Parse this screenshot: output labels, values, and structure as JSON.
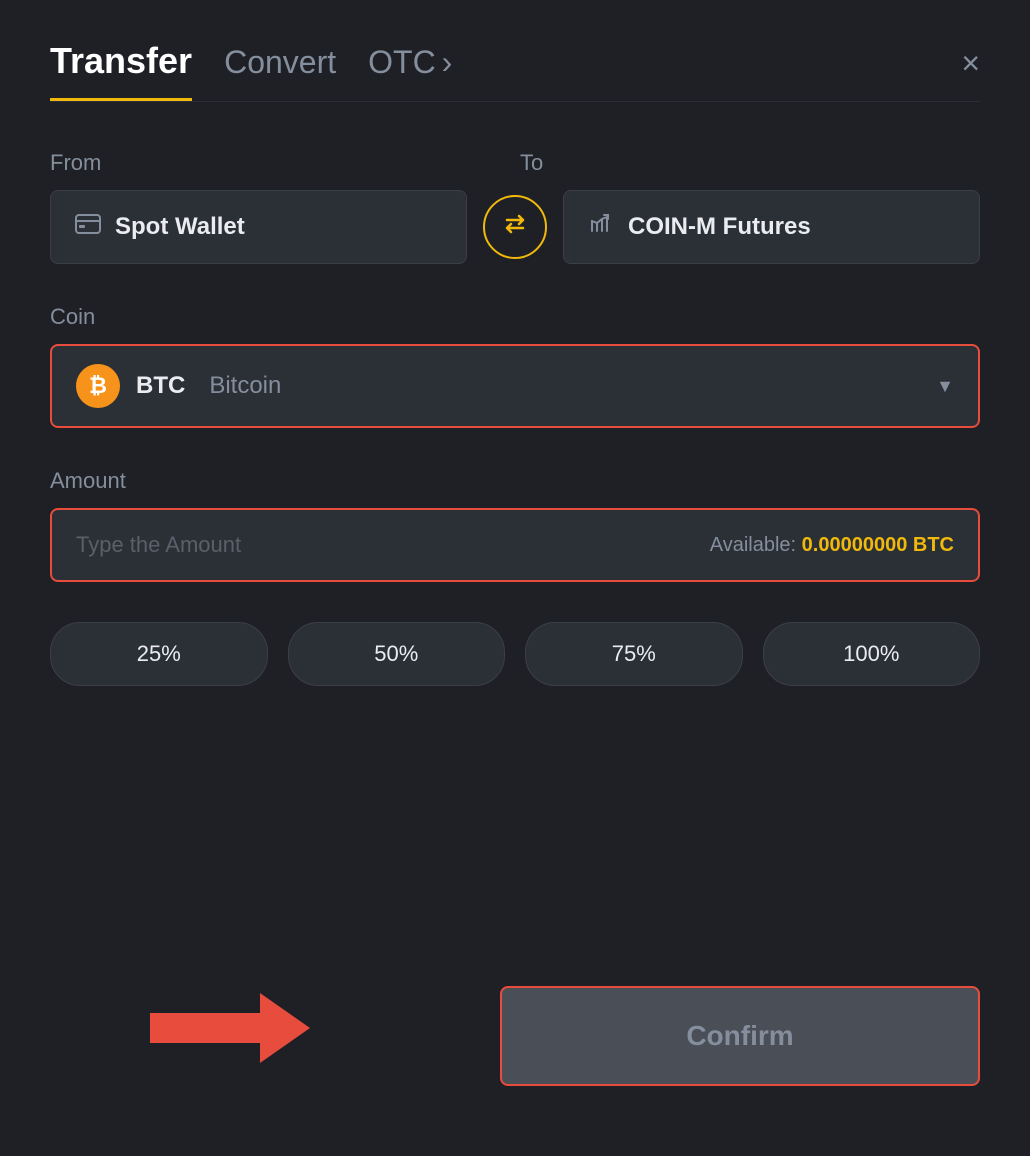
{
  "header": {
    "tab_transfer": "Transfer",
    "tab_convert": "Convert",
    "tab_otc": "OTC",
    "tab_otc_chevron": "›",
    "close_label": "×"
  },
  "from_section": {
    "label": "From",
    "wallet_name": "Spot Wallet"
  },
  "to_section": {
    "label": "To",
    "wallet_name": "COIN-M Futures"
  },
  "coin_section": {
    "label": "Coin",
    "coin_symbol": "BTC",
    "coin_name": "Bitcoin"
  },
  "amount_section": {
    "label": "Amount",
    "placeholder": "Type the Amount",
    "available_label": "Available:",
    "available_amount": "0.00000000 BTC"
  },
  "percent_buttons": [
    {
      "label": "25%"
    },
    {
      "label": "50%"
    },
    {
      "label": "75%"
    },
    {
      "label": "100%"
    }
  ],
  "confirm_button": {
    "label": "Confirm"
  }
}
